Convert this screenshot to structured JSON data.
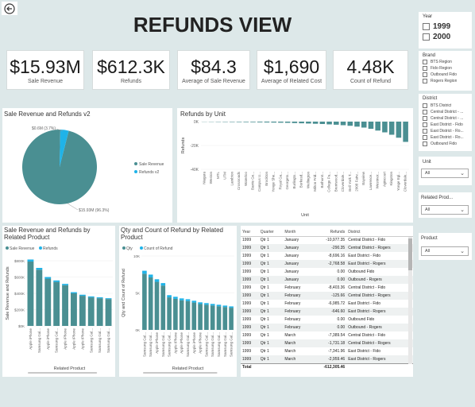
{
  "title": "REFUNDS VIEW",
  "kpis": [
    {
      "value": "$15.93M",
      "label": "Sale Revenue"
    },
    {
      "value": "$612.3K",
      "label": "Refunds"
    },
    {
      "value": "$84.3",
      "label": "Average of Sale Revenue"
    },
    {
      "value": "$1,690",
      "label": "Average of Related Cost"
    },
    {
      "value": "4.48K",
      "label": "Count of Refund"
    }
  ],
  "slicers": {
    "year": {
      "title": "Year",
      "items": [
        "1999",
        "2000"
      ]
    },
    "brand": {
      "title": "Brand",
      "items": [
        "BTS Region",
        "Fido Region",
        "Outbound Fido",
        "Rogers Region"
      ]
    },
    "district": {
      "title": "District",
      "items": [
        "BTS District",
        "Central District - ...",
        "Central District - ...",
        "East District - Fido",
        "East District - Ro...",
        "East District - Ro...",
        "Outbound Fido"
      ]
    },
    "unit": {
      "title": "Unit",
      "value": "All"
    },
    "related_product": {
      "title": "Related Prod...",
      "value": "All"
    },
    "product": {
      "title": "Product",
      "value": "All"
    }
  },
  "pie": {
    "title": "Sale Revenue and Refunds v2",
    "label_small": "$0.6M (3.7%)",
    "label_large": "$15.93M (96.3%)",
    "legend": [
      "Sale Revenue",
      "Refunds v2"
    ]
  },
  "chart_data": [
    {
      "type": "pie",
      "title": "Sale Revenue and Refunds v2",
      "categories": [
        "Sale Revenue",
        "Refunds v2"
      ],
      "values": [
        15.93,
        0.6
      ],
      "unit": "M",
      "colors": [
        "#4a8f92",
        "#1fb3e8"
      ]
    },
    {
      "type": "bar",
      "title": "Refunds by Unit",
      "xlabel": "Unit",
      "ylabel": "Refunds",
      "yticks": [
        "0K",
        "-20K",
        "-40K"
      ],
      "ylim": [
        -40000,
        0
      ],
      "categories": [
        "Niagara",
        "Weston",
        "MTL",
        "UTM",
        "Lambton",
        "Crossroads",
        "Waterloo",
        "Barrie Ge...",
        "Campus U...",
        "Brockton",
        "Yonge She...",
        "Royal Ga...",
        "Georgeto...",
        "Burlingto...",
        "Burkesd...",
        "Wellington",
        "Milton Frid...",
        "Bathurst...",
        "College Pa...",
        "Brentwood...",
        "Cloverdale...",
        "Bell York T...",
        "2008 Fairv...",
        "Bayview",
        "Lawrence...",
        "Westmor...",
        "Agincourt",
        "Kingston",
        "Yonge Egl...",
        "Cloverdale..."
      ],
      "values": [
        -150,
        -200,
        -250,
        -300,
        -350,
        -400,
        -450,
        -500,
        -600,
        -700,
        -800,
        -900,
        -1000,
        -1200,
        -1400,
        -1600,
        -1800,
        -2000,
        -2300,
        -2600,
        -3000,
        -3500,
        -4200,
        -5000,
        -6000,
        -7500,
        -9000,
        -11000,
        -13500,
        -17000
      ],
      "color": "#4a8f92"
    },
    {
      "type": "bar",
      "title": "Sale Revenue and Refunds by Related Product",
      "xlabel": "Related Product",
      "ylabel": "Sale Revenue and Refunds",
      "yticks": [
        "$800K",
        "$600K",
        "$400K",
        "$200K",
        "$0K"
      ],
      "ylim": [
        0,
        800000
      ],
      "categories": [
        "Apple iPhone",
        "Samsung Gal...",
        "Apple iPhone",
        "Samsung Gal...",
        "Apple iPhone",
        "Apple iPhone",
        "Apple iPhone",
        "Samsung Gal...",
        "Samsung Gal...",
        "Samsung Gal..."
      ],
      "series": [
        {
          "name": "Sale Revenue",
          "values": [
            790000,
            690000,
            580000,
            540000,
            500000,
            400000,
            370000,
            350000,
            340000,
            330000
          ],
          "color": "#4a8f92"
        },
        {
          "name": "Refunds",
          "values": [
            25000,
            22000,
            20000,
            18000,
            16000,
            14000,
            13000,
            12000,
            11000,
            10000
          ],
          "color": "#1fb3e8"
        }
      ]
    },
    {
      "type": "bar",
      "title": "Qty and Count of Refund by Related Product",
      "xlabel": "Related Product",
      "ylabel": "Qty and Count of Refund",
      "yticks": [
        "10K",
        "5K",
        "0K"
      ],
      "ylim": [
        0,
        10000
      ],
      "categories": [
        "Samsung Gal...",
        "Samsung Gal...",
        "Apple iPhone",
        "Samsung Gal...",
        "Samsung Gal...",
        "Apple iPhone",
        "Apple iPhone",
        "Samsung Gal...",
        "Apple iPhone",
        "Apple iPhone",
        "Samsung Gal...",
        "Samsung Gal...",
        "Samsung Gal...",
        "Samsung Gal...",
        "Samsung Gal..."
      ],
      "series": [
        {
          "name": "Qty",
          "values": [
            7600,
            7100,
            6500,
            6000,
            4400,
            4200,
            4000,
            3900,
            3700,
            3500,
            3400,
            3300,
            3200,
            3100,
            3000
          ],
          "color": "#4a8f92"
        },
        {
          "name": "Count of Refund",
          "values": [
            400,
            380,
            350,
            330,
            300,
            280,
            260,
            250,
            240,
            230,
            220,
            210,
            200,
            190,
            180
          ],
          "color": "#1fb3e8"
        }
      ]
    }
  ],
  "table": {
    "columns": [
      "Year",
      "Quarter",
      "Month",
      "Refunds",
      "District"
    ],
    "rows": [
      [
        "1999",
        "Qtr 1",
        "January",
        "-10,977.35",
        "Central District - Fido"
      ],
      [
        "1999",
        "Qtr 1",
        "January",
        "-290.35",
        "Central District - Rogers"
      ],
      [
        "1999",
        "Qtr 1",
        "January",
        "-8,696.16",
        "East District - Fido"
      ],
      [
        "1999",
        "Qtr 1",
        "January",
        "-2,768.58",
        "East District - Rogers"
      ],
      [
        "1999",
        "Qtr 1",
        "January",
        "0.00",
        "Outbound Fido"
      ],
      [
        "1999",
        "Qtr 1",
        "January",
        "0.00",
        "Outbound - Rogers"
      ],
      [
        "1999",
        "Qtr 1",
        "February",
        "-8,403.36",
        "Central District - Fido"
      ],
      [
        "1999",
        "Qtr 1",
        "February",
        "-125.66",
        "Central District - Rogers"
      ],
      [
        "1999",
        "Qtr 1",
        "February",
        "-6,985.72",
        "East District - Fido"
      ],
      [
        "1999",
        "Qtr 1",
        "February",
        "-646.60",
        "East District - Rogers"
      ],
      [
        "1999",
        "Qtr 1",
        "February",
        "0.00",
        "Outbound Fido"
      ],
      [
        "1999",
        "Qtr 1",
        "February",
        "0.00",
        "Outbound - Rogers"
      ],
      [
        "1999",
        "Qtr 1",
        "March",
        "-7,389.54",
        "Central District - Fido"
      ],
      [
        "1999",
        "Qtr 1",
        "March",
        "-1,731.18",
        "Central District - Rogers"
      ],
      [
        "1999",
        "Qtr 1",
        "March",
        "-7,341.96",
        "East District - Fido"
      ],
      [
        "1999",
        "Qtr 1",
        "March",
        "-2,959.46",
        "East District - Rogers"
      ]
    ],
    "total_label": "Total",
    "total_value": "-612,305.46"
  }
}
